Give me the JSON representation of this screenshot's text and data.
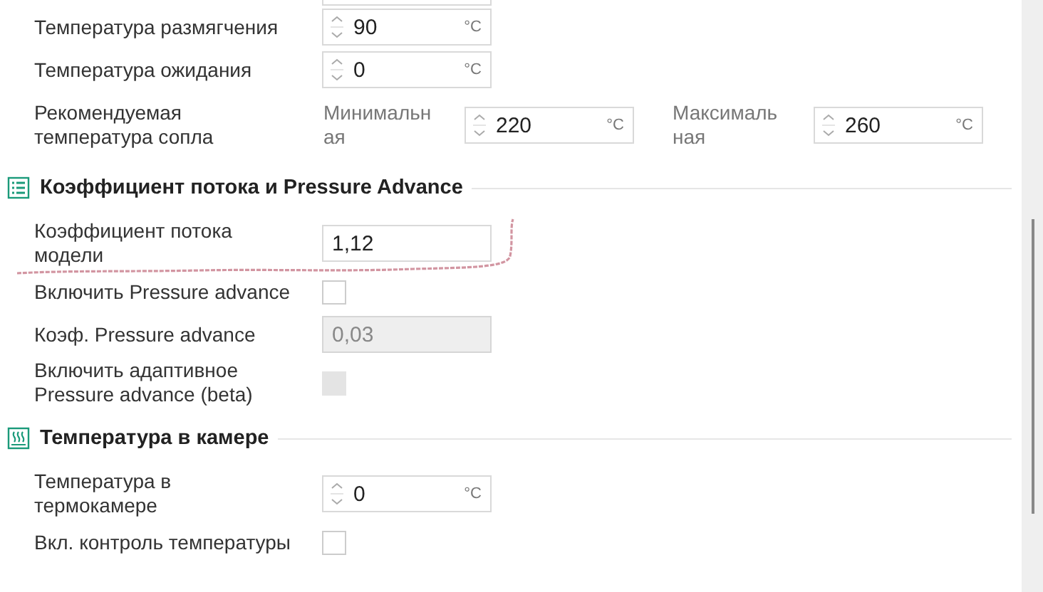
{
  "sections": [
    {
      "items": [
        {
          "kind": "spin",
          "label": "Температура размягчения",
          "value": "90",
          "unit": "°C"
        },
        {
          "kind": "spin",
          "label": "Температура ожидания",
          "value": "0",
          "unit": "°C"
        },
        {
          "kind": "range",
          "label": "Рекомендуемая температура сопла",
          "fields": [
            {
              "label": "Минимальная",
              "value": "220",
              "unit": "°C"
            },
            {
              "label": "Максимальная",
              "value": "260",
              "unit": "°C"
            }
          ]
        }
      ]
    },
    {
      "title": "Коэффициент потока и Pressure Advance",
      "items": [
        {
          "kind": "text",
          "label": "Коэффициент потока модели",
          "value": "1,12",
          "disabled": false,
          "annotated": true
        },
        {
          "kind": "checkbox",
          "label": "Включить Pressure advance",
          "checked": false,
          "disabled": false
        },
        {
          "kind": "text",
          "label": "Коэф. Pressure advance",
          "value": "0,03",
          "disabled": true
        },
        {
          "kind": "checkbox",
          "label": "Включить адаптивное Pressure advance (beta)",
          "checked": false,
          "disabled": true
        }
      ]
    },
    {
      "title": "Температура в камере",
      "items": [
        {
          "kind": "spin",
          "label": "Температура в термокамере",
          "value": "0",
          "unit": "°C"
        },
        {
          "kind": "checkbox",
          "label": "Вкл. контроль температуры",
          "checked": false,
          "disabled": false
        }
      ]
    }
  ]
}
